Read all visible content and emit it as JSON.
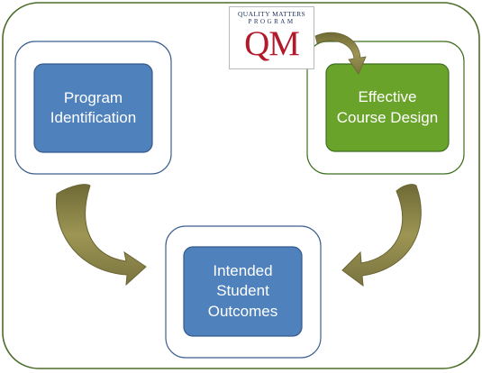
{
  "boxes": {
    "program": {
      "label": "Program\nIdentification"
    },
    "effective": {
      "label": "Effective\nCourse Design"
    },
    "intended": {
      "label": "Intended\nStudent\nOutcomes"
    }
  },
  "logo": {
    "line1": "QUALITY MATTERS",
    "line2": "PROGRAM",
    "mark": "QM"
  },
  "colors": {
    "blue_box": "#4f81bd",
    "blue_border": "#3b5f8f",
    "green_box": "#6aa32a",
    "green_border": "#3f6e1e",
    "outer_frame": "#4b6d2a",
    "arrow_fill": "#8b8447",
    "logo_red": "#b3192b",
    "logo_navy": "#1e2f5e"
  }
}
